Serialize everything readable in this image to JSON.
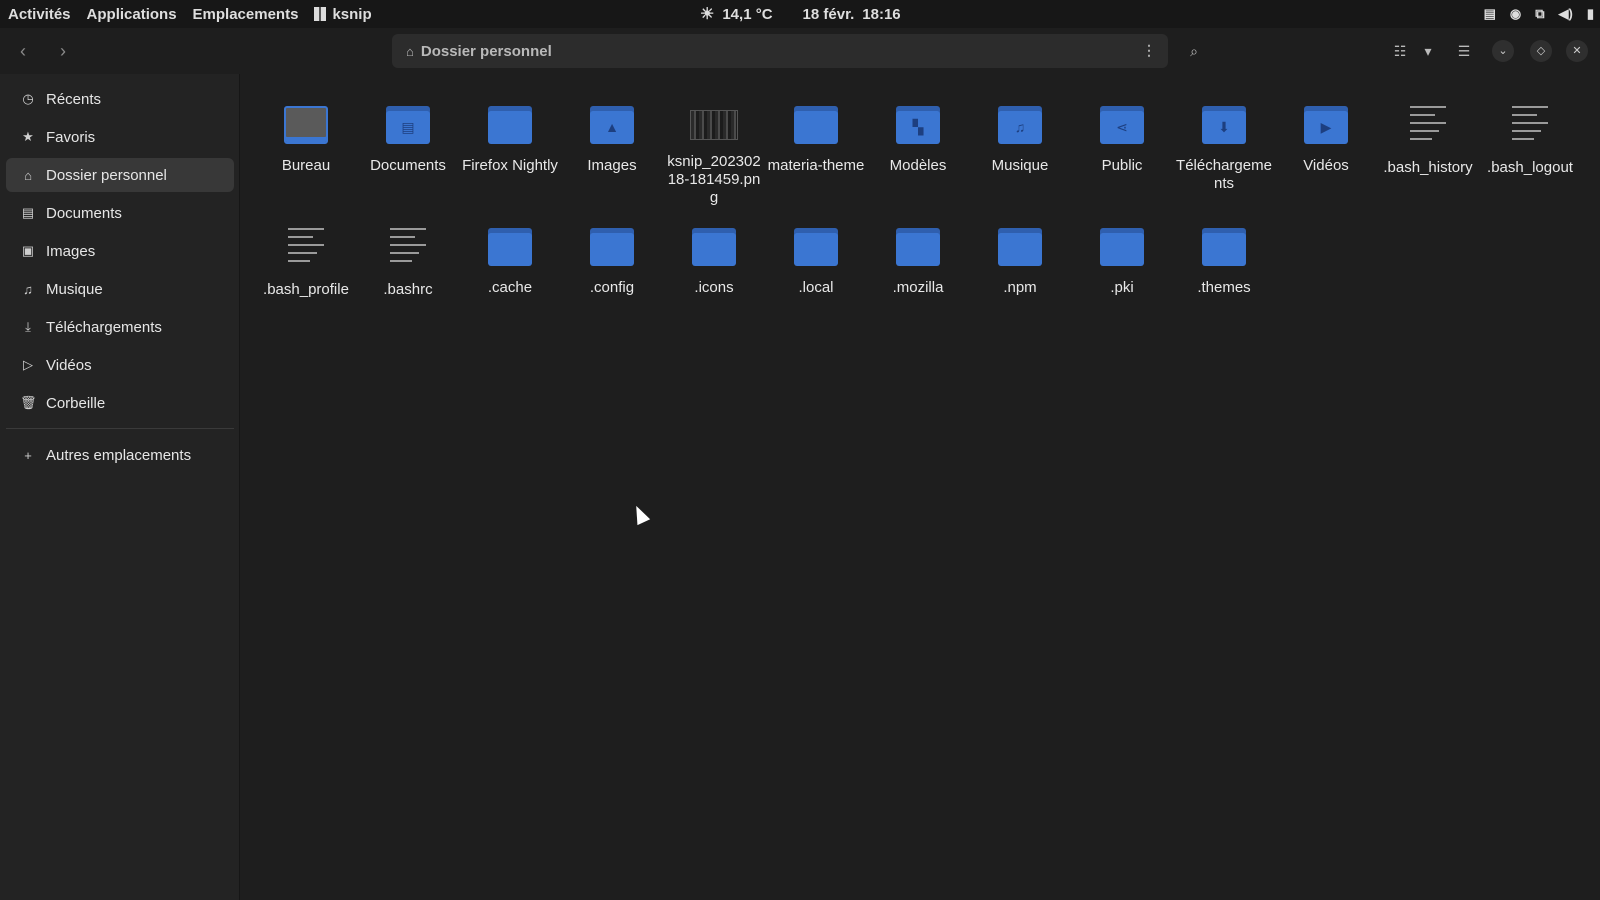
{
  "topbar": {
    "activities": "Activités",
    "applications": "Applications",
    "places": "Emplacements",
    "app_name": "ksnip",
    "weather_icon": "sun-icon",
    "temperature": "14,1 °C",
    "date": "18 févr.",
    "time": "18:16",
    "tray_icons": [
      "clipboard-icon",
      "privacy-mask-icon",
      "windows-icon",
      "volume-icon",
      "battery-icon"
    ]
  },
  "headerbar": {
    "path_label": "Dossier personnel",
    "back_icon": "chevron-left-icon",
    "forward_icon": "chevron-right-icon"
  },
  "sidebar": {
    "items": [
      {
        "label": "Récents",
        "icon": "clock-icon"
      },
      {
        "label": "Favoris",
        "icon": "star-icon"
      },
      {
        "label": "Dossier personnel",
        "icon": "home-icon",
        "active": true
      },
      {
        "label": "Documents",
        "icon": "document-icon"
      },
      {
        "label": "Images",
        "icon": "image-icon"
      },
      {
        "label": "Musique",
        "icon": "music-icon"
      },
      {
        "label": "Téléchargements",
        "icon": "download-icon"
      },
      {
        "label": "Vidéos",
        "icon": "play-icon"
      },
      {
        "label": "Corbeille",
        "icon": "trash-icon"
      },
      {
        "label": "Autres emplacements",
        "icon": "plus-icon"
      }
    ]
  },
  "files": [
    {
      "name": "Bureau",
      "type": "desktop"
    },
    {
      "name": "Documents",
      "type": "folder",
      "glyph": "document-icon"
    },
    {
      "name": "Firefox Nightly",
      "type": "folder"
    },
    {
      "name": "Images",
      "type": "folder",
      "glyph": "image-icon"
    },
    {
      "name": "ksnip_20230218-181459.png",
      "type": "image"
    },
    {
      "name": "materia-theme",
      "type": "folder"
    },
    {
      "name": "Modèles",
      "type": "folder",
      "glyph": "template-icon"
    },
    {
      "name": "Musique",
      "type": "folder",
      "glyph": "music-icon"
    },
    {
      "name": "Public",
      "type": "folder",
      "glyph": "share-icon"
    },
    {
      "name": "Téléchargements",
      "type": "folder",
      "glyph": "download-icon"
    },
    {
      "name": "Vidéos",
      "type": "folder",
      "glyph": "play-icon"
    },
    {
      "name": ".bash_history",
      "type": "text"
    },
    {
      "name": ".bash_logout",
      "type": "text"
    },
    {
      "name": ".bash_profile",
      "type": "text"
    },
    {
      "name": ".bashrc",
      "type": "text"
    },
    {
      "name": ".cache",
      "type": "folder"
    },
    {
      "name": ".config",
      "type": "folder"
    },
    {
      "name": ".icons",
      "type": "folder"
    },
    {
      "name": ".local",
      "type": "folder"
    },
    {
      "name": ".mozilla",
      "type": "folder"
    },
    {
      "name": ".npm",
      "type": "folder"
    },
    {
      "name": ".pki",
      "type": "folder"
    },
    {
      "name": ".themes",
      "type": "folder"
    }
  ]
}
